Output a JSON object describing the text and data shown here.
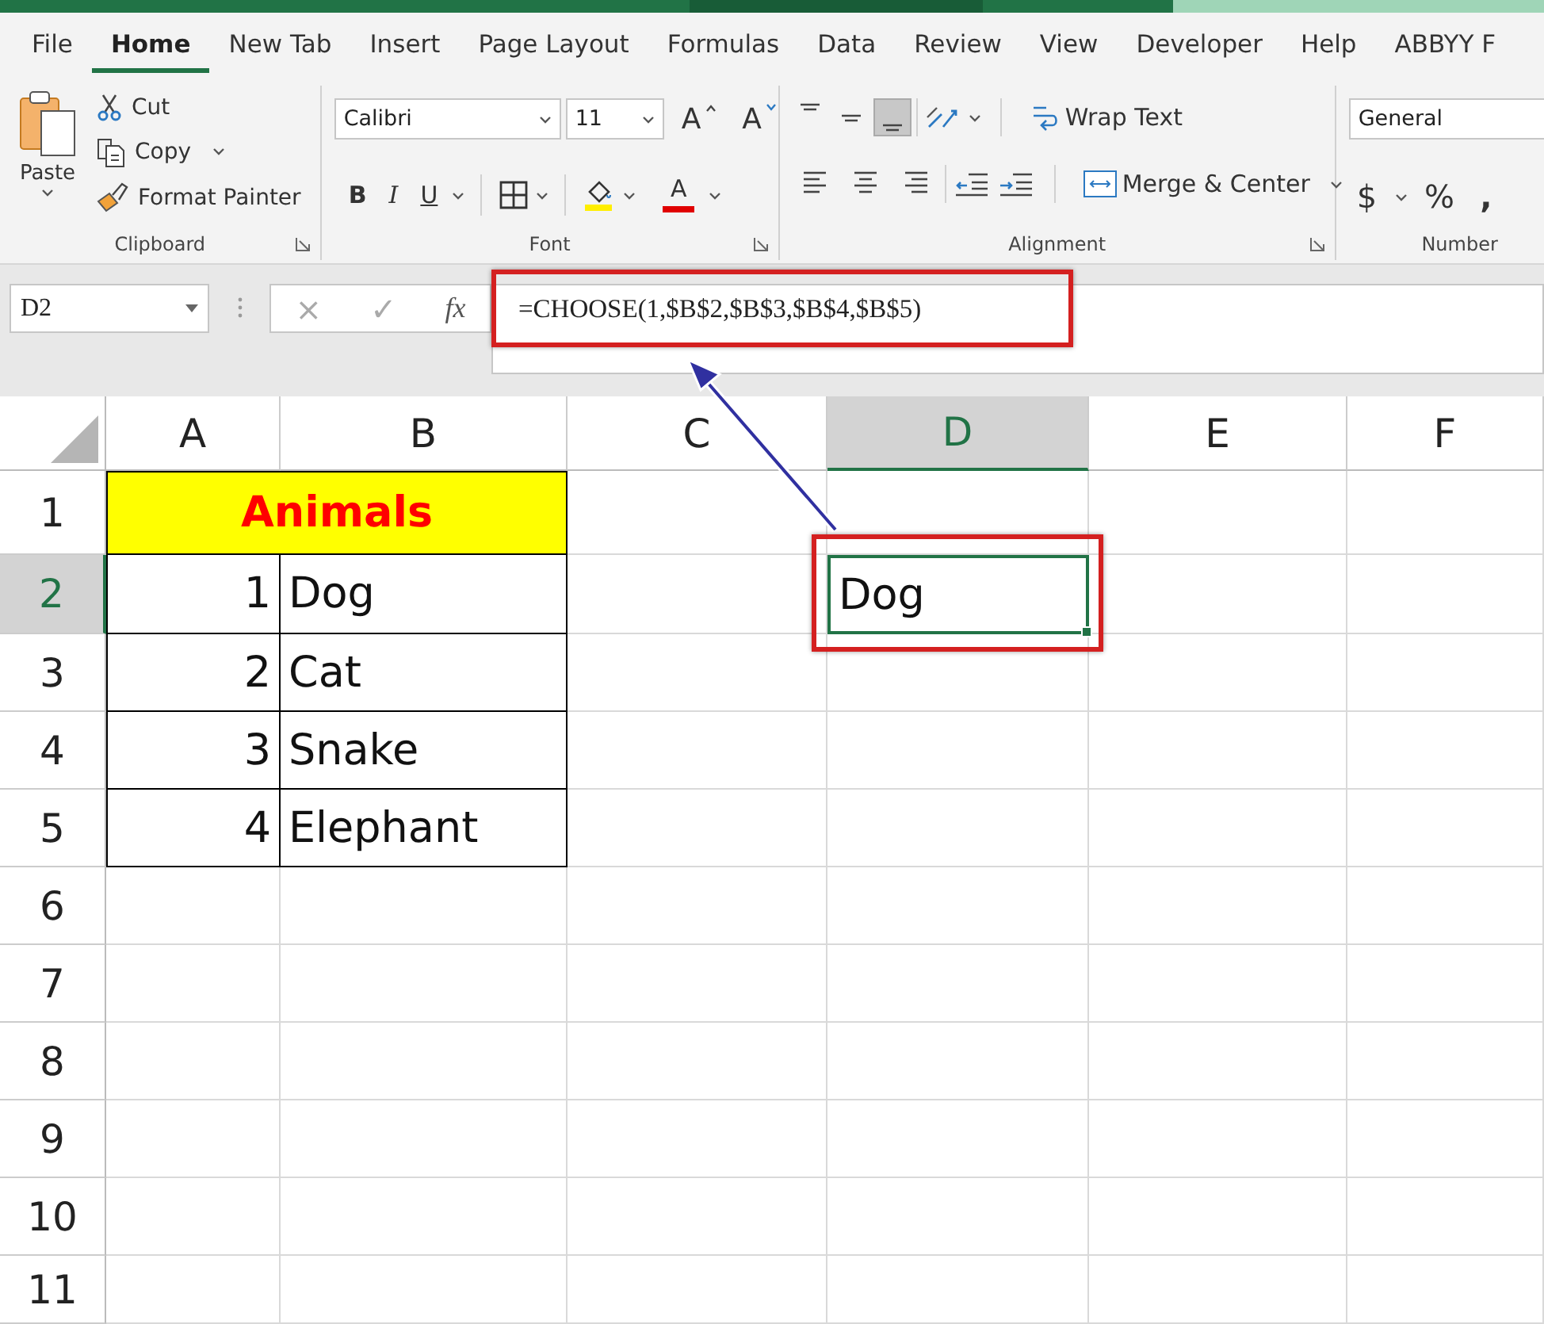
{
  "tabs": [
    {
      "label": "File",
      "selected": false
    },
    {
      "label": "Home",
      "selected": true
    },
    {
      "label": "New Tab",
      "selected": false
    },
    {
      "label": "Insert",
      "selected": false
    },
    {
      "label": "Page Layout",
      "selected": false
    },
    {
      "label": "Formulas",
      "selected": false
    },
    {
      "label": "Data",
      "selected": false
    },
    {
      "label": "Review",
      "selected": false
    },
    {
      "label": "View",
      "selected": false
    },
    {
      "label": "Developer",
      "selected": false
    },
    {
      "label": "Help",
      "selected": false
    },
    {
      "label": "ABBYY F",
      "selected": false
    }
  ],
  "ribbon": {
    "clipboard": {
      "label": "Clipboard",
      "paste": "Paste",
      "items": [
        {
          "label": "Cut",
          "kind": "cut",
          "dropdown": false
        },
        {
          "label": "Copy",
          "kind": "copy",
          "dropdown": true
        },
        {
          "label": "Format Painter",
          "kind": "painter",
          "dropdown": false
        }
      ]
    },
    "font": {
      "label": "Font",
      "font_name": "Calibri",
      "font_size": "11",
      "size_buttons": [
        {
          "label": "A",
          "kind": "grow"
        },
        {
          "label": "A",
          "kind": "shrink"
        }
      ],
      "style_buttons": [
        {
          "label": "B",
          "kind": "bold"
        },
        {
          "label": "I",
          "kind": "italic"
        },
        {
          "label": "U",
          "kind": "underline"
        }
      ],
      "font_color": "A"
    },
    "alignment": {
      "label": "Alignment",
      "vertical": [
        {
          "kind": "top",
          "selected": false
        },
        {
          "kind": "middle",
          "selected": false
        },
        {
          "kind": "bottom",
          "selected": true
        }
      ],
      "wrap_text": "Wrap Text",
      "merge": "Merge & Center"
    },
    "number": {
      "label": "Number",
      "format": "General",
      "symbols": [
        {
          "label": "$",
          "dropdown": true
        },
        {
          "label": "%",
          "dropdown": false
        },
        {
          "label": ",",
          "dropdown": false
        }
      ]
    }
  },
  "formula_bar": {
    "name_box": "D2",
    "cancel": "×",
    "enter": "✓",
    "fx": "fx",
    "formula": "=CHOOSE(1,$B$2,$B$3,$B$4,$B$5)"
  },
  "columns": [
    {
      "label": "A",
      "selected": false
    },
    {
      "label": "B",
      "selected": false
    },
    {
      "label": "C",
      "selected": false
    },
    {
      "label": "D",
      "selected": true
    },
    {
      "label": "E",
      "selected": false
    },
    {
      "label": "F",
      "selected": false
    }
  ],
  "rows": [
    {
      "label": "1",
      "selected": false,
      "cells": [
        {
          "kind": "header",
          "text": "Animals",
          "merged": true,
          "selected": false
        },
        {
          "kind": "blank",
          "merged": false,
          "selected": false
        },
        {
          "kind": "blank",
          "merged": false,
          "selected": false
        },
        {
          "kind": "blank",
          "merged": false,
          "selected": false
        },
        {
          "kind": "blank",
          "merged": false,
          "selected": false
        }
      ]
    },
    {
      "label": "2",
      "selected": true,
      "cells": [
        {
          "kind": "number",
          "text": "1",
          "merged": false,
          "selected": false
        },
        {
          "kind": "text",
          "text": "Dog",
          "merged": false,
          "selected": false
        },
        {
          "kind": "blank",
          "merged": false,
          "selected": false
        },
        {
          "kind": "plain",
          "text": "Dog",
          "merged": false,
          "selected": true
        },
        {
          "kind": "blank",
          "merged": false,
          "selected": false
        },
        {
          "kind": "blank",
          "merged": false,
          "selected": false
        }
      ]
    },
    {
      "label": "3",
      "selected": false,
      "cells": [
        {
          "kind": "number",
          "text": "2",
          "merged": false,
          "selected": false
        },
        {
          "kind": "text",
          "text": "Cat",
          "merged": false,
          "selected": false
        },
        {
          "kind": "blank",
          "merged": false,
          "selected": false
        },
        {
          "kind": "blank",
          "merged": false,
          "selected": false
        },
        {
          "kind": "blank",
          "merged": false,
          "selected": false
        },
        {
          "kind": "blank",
          "merged": false,
          "selected": false
        }
      ]
    },
    {
      "label": "4",
      "selected": false,
      "cells": [
        {
          "kind": "number",
          "text": "3",
          "merged": false,
          "selected": false
        },
        {
          "kind": "text",
          "text": "Snake",
          "merged": false,
          "selected": false
        },
        {
          "kind": "blank",
          "merged": false,
          "selected": false
        },
        {
          "kind": "blank",
          "merged": false,
          "selected": false
        },
        {
          "kind": "blank",
          "merged": false,
          "selected": false
        },
        {
          "kind": "blank",
          "merged": false,
          "selected": false
        }
      ]
    },
    {
      "label": "5",
      "selected": false,
      "cells": [
        {
          "kind": "number",
          "text": "4",
          "merged": false,
          "selected": false
        },
        {
          "kind": "text",
          "text": "Elephant",
          "merged": false,
          "selected": false
        },
        {
          "kind": "blank",
          "merged": false,
          "selected": false
        },
        {
          "kind": "blank",
          "merged": false,
          "selected": false
        },
        {
          "kind": "blank",
          "merged": false,
          "selected": false
        },
        {
          "kind": "blank",
          "merged": false,
          "selected": false
        }
      ]
    },
    {
      "label": "6",
      "selected": false,
      "cells": [
        {
          "kind": "blank",
          "merged": false,
          "selected": false
        },
        {
          "kind": "blank",
          "merged": false,
          "selected": false
        },
        {
          "kind": "blank",
          "merged": false,
          "selected": false
        },
        {
          "kind": "blank",
          "merged": false,
          "selected": false
        },
        {
          "kind": "blank",
          "merged": false,
          "selected": false
        },
        {
          "kind": "blank",
          "merged": false,
          "selected": false
        }
      ]
    },
    {
      "label": "7",
      "selected": false,
      "cells": [
        {
          "kind": "blank",
          "merged": false,
          "selected": false
        },
        {
          "kind": "blank",
          "merged": false,
          "selected": false
        },
        {
          "kind": "blank",
          "merged": false,
          "selected": false
        },
        {
          "kind": "blank",
          "merged": false,
          "selected": false
        },
        {
          "kind": "blank",
          "merged": false,
          "selected": false
        },
        {
          "kind": "blank",
          "merged": false,
          "selected": false
        }
      ]
    },
    {
      "label": "8",
      "selected": false,
      "cells": [
        {
          "kind": "blank",
          "merged": false,
          "selected": false
        },
        {
          "kind": "blank",
          "merged": false,
          "selected": false
        },
        {
          "kind": "blank",
          "merged": false,
          "selected": false
        },
        {
          "kind": "blank",
          "merged": false,
          "selected": false
        },
        {
          "kind": "blank",
          "merged": false,
          "selected": false
        },
        {
          "kind": "blank",
          "merged": false,
          "selected": false
        }
      ]
    },
    {
      "label": "9",
      "selected": false,
      "cells": [
        {
          "kind": "blank",
          "merged": false,
          "selected": false
        },
        {
          "kind": "blank",
          "merged": false,
          "selected": false
        },
        {
          "kind": "blank",
          "merged": false,
          "selected": false
        },
        {
          "kind": "blank",
          "merged": false,
          "selected": false
        },
        {
          "kind": "blank",
          "merged": false,
          "selected": false
        },
        {
          "kind": "blank",
          "merged": false,
          "selected": false
        }
      ]
    },
    {
      "label": "10",
      "selected": false,
      "cells": [
        {
          "kind": "blank",
          "merged": false,
          "selected": false
        },
        {
          "kind": "blank",
          "merged": false,
          "selected": false
        },
        {
          "kind": "blank",
          "merged": false,
          "selected": false
        },
        {
          "kind": "blank",
          "merged": false,
          "selected": false
        },
        {
          "kind": "blank",
          "merged": false,
          "selected": false
        },
        {
          "kind": "blank",
          "merged": false,
          "selected": false
        }
      ]
    },
    {
      "label": "11",
      "selected": false,
      "cells": [
        {
          "kind": "blank",
          "merged": false,
          "selected": false
        },
        {
          "kind": "blank",
          "merged": false,
          "selected": false
        },
        {
          "kind": "blank",
          "merged": false,
          "selected": false
        },
        {
          "kind": "blank",
          "merged": false,
          "selected": false
        },
        {
          "kind": "blank",
          "merged": false,
          "selected": false
        },
        {
          "kind": "blank",
          "merged": false,
          "selected": false
        }
      ]
    }
  ]
}
